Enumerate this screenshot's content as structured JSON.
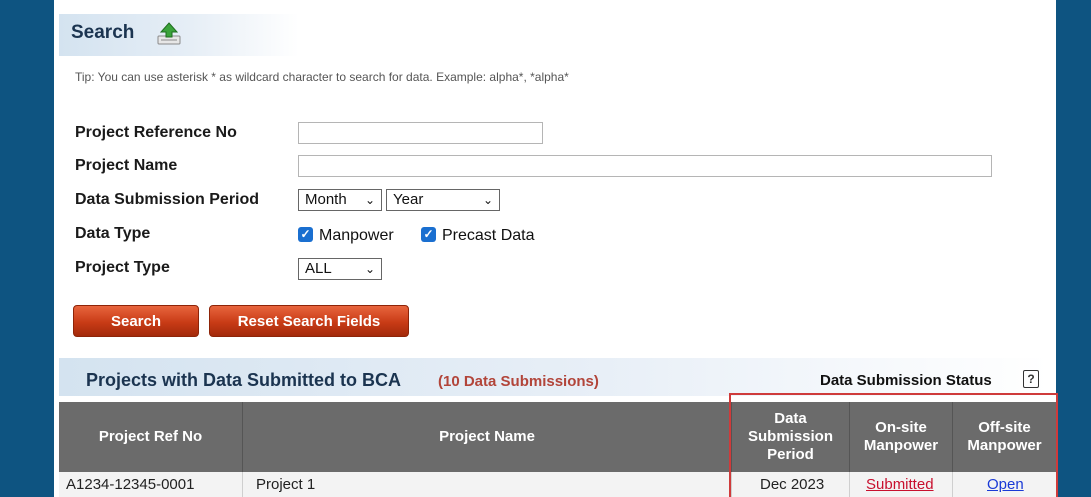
{
  "search": {
    "title": "Search",
    "tip": "Tip: You can use asterisk * as wildcard character to search for data. Example: alpha*, *alpha*",
    "fields": {
      "project_ref_label": "Project Reference No",
      "project_ref_value": "",
      "project_name_label": "Project Name",
      "project_name_value": "",
      "period_label": "Data Submission Period",
      "month_selected": "Month",
      "year_selected": "Year",
      "data_type_label": "Data Type",
      "manpower_label": "Manpower",
      "manpower_checked": true,
      "precast_label": "Precast Data",
      "precast_checked": true,
      "project_type_label": "Project Type",
      "project_type_selected": "ALL"
    },
    "buttons": {
      "search": "Search",
      "reset": "Reset Search Fields"
    }
  },
  "results": {
    "title": "Projects with Data Submitted to BCA",
    "count": "(10 Data Submissions)",
    "status_label": "Data Submission Status",
    "help_glyph": "?",
    "columns": {
      "ref": "Project Ref No",
      "name": "Project Name",
      "period": "Data Submission Period",
      "onsite": "On-site Manpower",
      "offsite": "Off-site Manpower"
    },
    "rows": [
      {
        "ref": "A1234-12345-0001",
        "name": "Project 1",
        "period": "Dec 2023",
        "onsite": "Submitted",
        "offsite": "Open"
      }
    ]
  },
  "colors": {
    "sidebar": "#0e5481",
    "header_text": "#1b3450",
    "button": "#c83b16",
    "table_header": "#6b6b6b",
    "highlight": "#cf3b3b",
    "submitted_link": "#c8102e",
    "open_link": "#1a3ad6"
  },
  "icons": {
    "upload": "upload-icon",
    "help": "help-icon",
    "checkbox": "checkmark"
  }
}
